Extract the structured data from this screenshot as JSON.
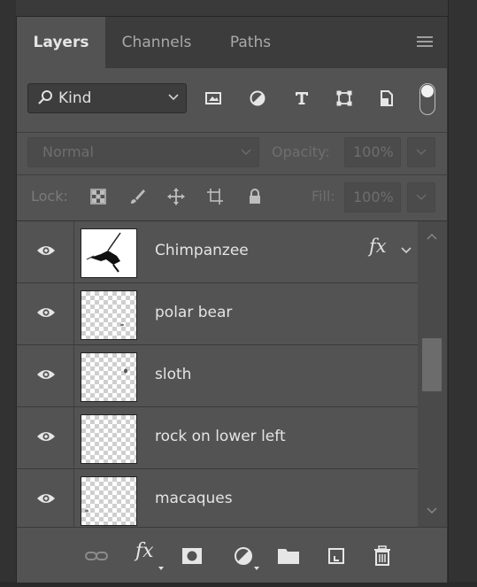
{
  "tabs": [
    {
      "label": "Layers",
      "active": true
    },
    {
      "label": "Channels",
      "active": false
    },
    {
      "label": "Paths",
      "active": false
    }
  ],
  "filter": {
    "kind_label": "Kind",
    "filter_icons": [
      "image-filter-icon",
      "adjustment-filter-icon",
      "type-filter-icon",
      "shape-filter-icon",
      "smart-object-filter-icon"
    ]
  },
  "blend": {
    "mode": "Normal",
    "opacity_label": "Opacity:",
    "opacity_value": "100%"
  },
  "lock": {
    "label": "Lock:",
    "fill_label": "Fill:",
    "fill_value": "100%"
  },
  "layers": [
    {
      "name": "Chimpanzee",
      "visible": true,
      "has_fx": true,
      "fx_label": "fx"
    },
    {
      "name": "polar bear",
      "visible": true,
      "has_fx": false
    },
    {
      "name": "sloth",
      "visible": true,
      "has_fx": false
    },
    {
      "name": "rock on lower left",
      "visible": true,
      "has_fx": false
    },
    {
      "name": "macaques",
      "visible": true,
      "has_fx": false
    }
  ],
  "bottom_bar": {
    "fx_label": "fx",
    "icons": [
      "link-layers-icon",
      "layer-style-icon",
      "mask-icon",
      "adjustment-layer-icon",
      "group-folder-icon",
      "new-layer-icon",
      "trash-icon"
    ]
  },
  "colors": {
    "panel_bg": "#535353",
    "tab_bar_bg": "#3c3c3c",
    "text": "#e4e4e4",
    "disabled_text": "#6e6e6e"
  }
}
